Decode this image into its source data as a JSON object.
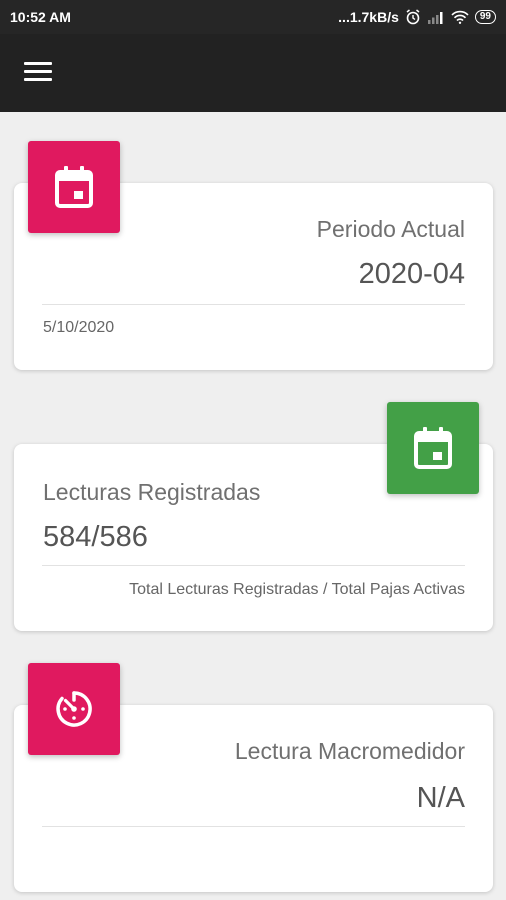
{
  "status_bar": {
    "time": "10:52 AM",
    "network_speed": "...1.7kB/s",
    "battery": "99"
  },
  "cards": [
    {
      "title": "Periodo Actual",
      "value": "2020-04",
      "footer": "5/10/2020",
      "icon": "calendar-icon",
      "color": "#e0195f"
    },
    {
      "title": "Lecturas Registradas",
      "value": "584/586",
      "footer": "Total Lecturas Registradas / Total Pajas Activas",
      "icon": "calendar-icon",
      "color": "#43a047"
    },
    {
      "title": "Lectura Macromedidor",
      "value": "N/A",
      "footer": "",
      "icon": "timer-icon",
      "color": "#e0195f"
    }
  ]
}
